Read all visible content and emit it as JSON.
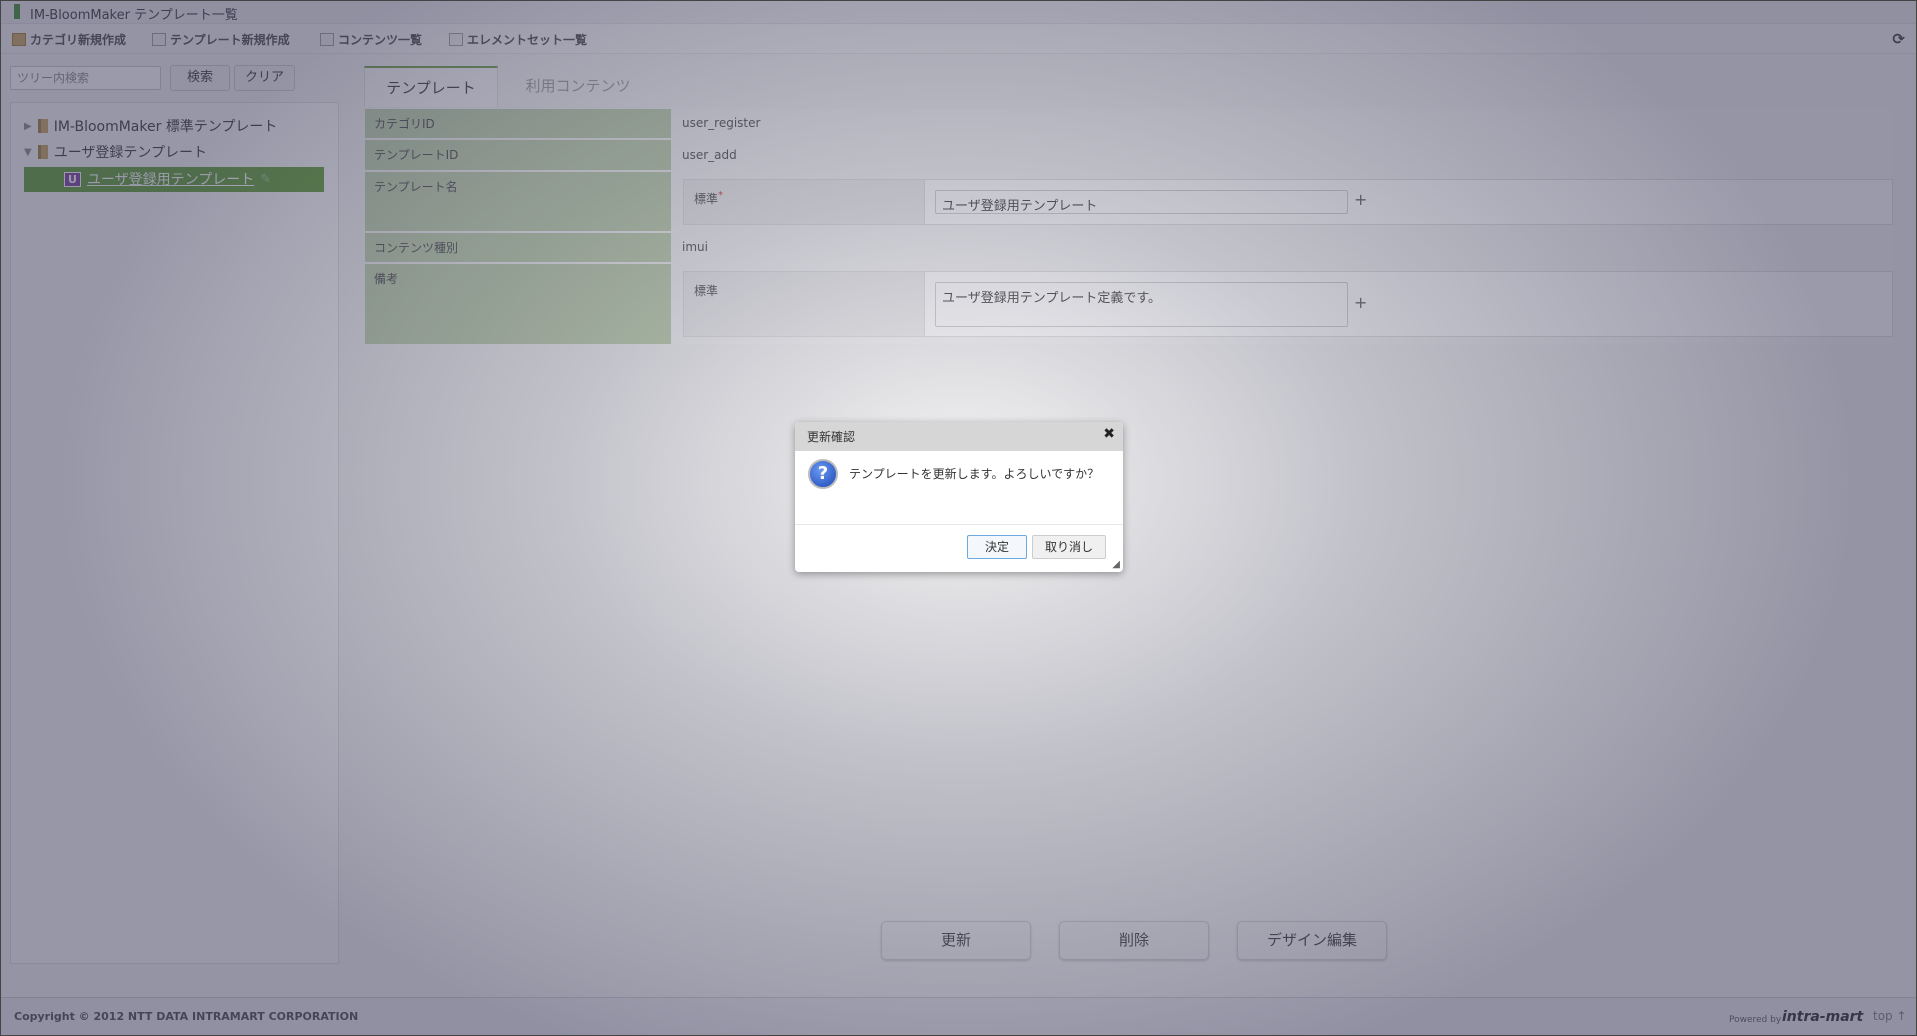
{
  "window": {
    "title": "IM-BloomMaker テンプレート一覧"
  },
  "toolbar": {
    "items": [
      {
        "label": "カテゴリ新規作成",
        "icon": "folder-add-icon"
      },
      {
        "label": "テンプレート新規作成",
        "icon": "template-add-icon"
      },
      {
        "label": "コンテンツ一覧",
        "icon": "list-icon"
      },
      {
        "label": "エレメントセット一覧",
        "icon": "list-icon"
      }
    ],
    "refresh_icon": "refresh-icon"
  },
  "sidebar": {
    "search_placeholder": "ツリー内検索",
    "search_label": "検索",
    "clear_label": "クリア",
    "tree": [
      {
        "label": "IM-BloomMaker 標準テンプレート",
        "expanded": false
      },
      {
        "label": "ユーザ登録テンプレート",
        "expanded": true,
        "children": [
          {
            "label": "ユーザ登録用テンプレート",
            "badge": "U",
            "selected": true
          }
        ]
      }
    ]
  },
  "tabs": [
    {
      "label": "テンプレート",
      "active": true
    },
    {
      "label": "利用コンテンツ",
      "active": false
    }
  ],
  "form": {
    "category_id": {
      "label": "カテゴリID",
      "value": "user_register"
    },
    "template_id": {
      "label": "テンプレートID",
      "value": "user_add"
    },
    "template_name": {
      "label": "テンプレート名",
      "locale_label": "標準",
      "required_mark": "*",
      "value": "ユーザ登録用テンプレート"
    },
    "content_type": {
      "label": "コンテンツ種別",
      "value": "imui"
    },
    "remarks": {
      "label": "備考",
      "locale_label": "標準",
      "value": "ユーザ登録用テンプレート定義です。"
    },
    "plus": "+"
  },
  "actions": {
    "update": "更新",
    "delete": "削除",
    "design": "デザイン編集"
  },
  "footer": {
    "copyright": "Copyright © 2012 NTT DATA INTRAMART CORPORATION",
    "powered_by": "Powered by",
    "brand": "intra-mart",
    "top_link": "top ↑"
  },
  "dialog": {
    "title": "更新確認",
    "close": "✖",
    "icon": "question-icon",
    "message": "テンプレートを更新します。よろしいですか？",
    "ok": "決定",
    "cancel": "取り消し"
  },
  "colors": {
    "label_bg": "#b8cca5",
    "selected_tree": "#5a9a2c",
    "accent": "#6a9a40"
  }
}
